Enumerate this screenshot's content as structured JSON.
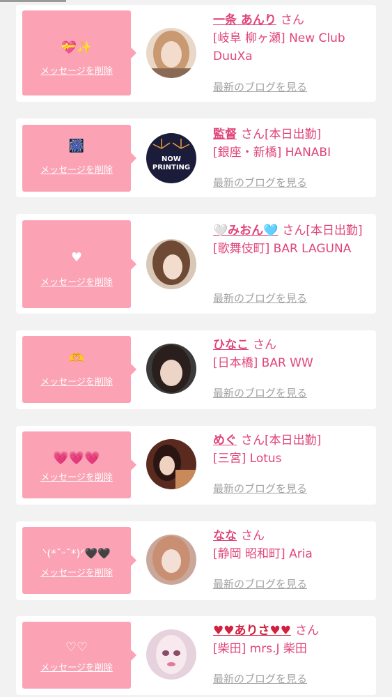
{
  "delete_label": "メッセージを削除",
  "blog_label": "最新のブログを見る",
  "honorific": "さん",
  "avatar_now_printing": "NOW PRINTING",
  "colors": {
    "bubble": "#fba2b4",
    "accent": "#e0447a",
    "muted": "#a3a3a3"
  },
  "messages": [
    {
      "emoji": "💝✨",
      "name": "一条 あんり",
      "status": "",
      "shop": "[岐阜 柳ヶ瀬] New Club DuuXa"
    },
    {
      "emoji": "🎆",
      "name": "監督",
      "status": "[本日出勤]",
      "shop": "[銀座・新橋] HANABI"
    },
    {
      "emoji": "♥",
      "name": "🤍みおん🩵",
      "status": "[本日出勤]",
      "shop": "[歌舞伎町] BAR LAGUNA"
    },
    {
      "emoji": "🫶",
      "name": "ひなこ",
      "status": "",
      "shop": "[日本橋] BAR WW"
    },
    {
      "emoji": "💗💗💗",
      "name": "めぐ",
      "status": "[本日出勤]",
      "shop": "[三宮] Lotus"
    },
    {
      "emoji": "ᐠ(*˘ᵕ˘*)ᐟ🖤🖤",
      "name": "なな",
      "status": "",
      "shop": "[静岡 昭和町] Aria"
    },
    {
      "emoji": "♡♡",
      "name": "♥♥ありさ♥♥",
      "status": "",
      "shop": "[柴田] mrs.J 柴田"
    }
  ]
}
